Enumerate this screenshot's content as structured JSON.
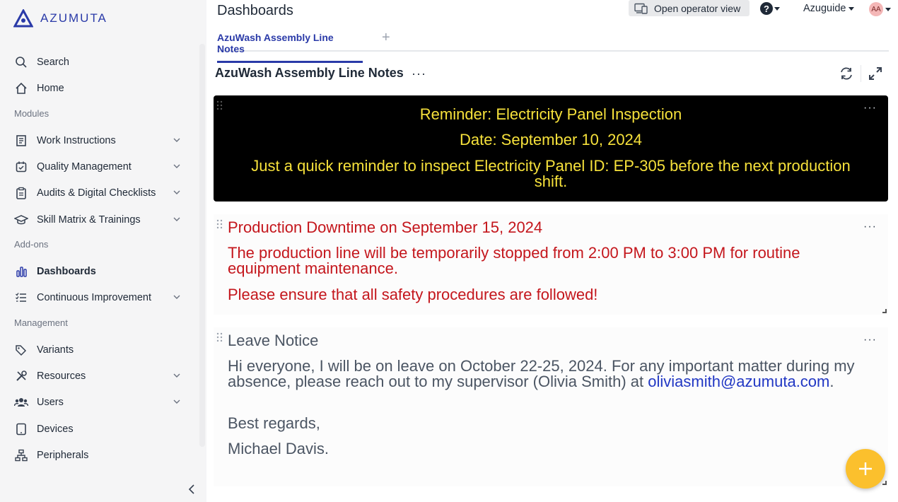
{
  "brand": {
    "name": "AZUMUTA",
    "color": "#2a3aa8"
  },
  "sidebar": {
    "items": [
      {
        "label": "Search",
        "icon": "search-icon"
      },
      {
        "label": "Home",
        "icon": "home-icon"
      },
      {
        "label": "Work Instructions",
        "icon": "document-icon"
      },
      {
        "label": "Quality Management",
        "icon": "calendar-check-icon"
      },
      {
        "label": "Audits & Digital Checklists",
        "icon": "clipboard-icon"
      },
      {
        "label": "Skill Matrix & Trainings",
        "icon": "graduation-cap-icon"
      },
      {
        "label": "Dashboards",
        "icon": "bar-chart-icon"
      },
      {
        "label": "Continuous Improvement",
        "icon": "checklist-icon"
      },
      {
        "label": "Variants",
        "icon": "tags-icon"
      },
      {
        "label": "Resources",
        "icon": "tools-icon"
      },
      {
        "label": "Users",
        "icon": "users-icon"
      },
      {
        "label": "Devices",
        "icon": "tablet-icon"
      },
      {
        "label": "Peripherals",
        "icon": "network-icon"
      }
    ],
    "sections": {
      "modules": "Modules",
      "addons": "Add-ons",
      "management": "Management"
    },
    "active": "Dashboards"
  },
  "header": {
    "title": "Dashboards",
    "operator_view": "Open operator view",
    "help": "?",
    "user": "Azuguide",
    "avatar_initials": "AA"
  },
  "tabs": {
    "active": "AzuWash Assembly Line Notes",
    "add": "+"
  },
  "dashboard": {
    "title": "AzuWash Assembly Line Notes",
    "menu": "···"
  },
  "widgets": {
    "reminder": {
      "title": "Reminder: Electricity Panel Inspection",
      "date": "Date: September 10, 2024",
      "body": "Just a quick reminder to inspect Electricity Panel ID: EP-305 before the next production shift."
    },
    "downtime": {
      "title": "Production Downtime on September 15, 2024",
      "body": "The production line will be temporarily stopped from 2:00 PM to 3:00 PM for routine equipment maintenance.",
      "warning": "Please ensure that all safety procedures are followed!"
    },
    "leave": {
      "title": "Leave Notice",
      "body": "Hi everyone, I will be on leave on October 22-25, 2024. For any important matter during my absence, please reach out to my supervisor (Olivia Smith) at",
      "email": "oliviasmith@azumuta.com",
      "period": ".",
      "closing": "Best regards,",
      "signature": "Michael Davis."
    },
    "menu": "···"
  },
  "colors": {
    "accent": "#2a3aa8",
    "reminder_text": "#f6e13b",
    "alert_red": "#c4161c",
    "fab": "#fbc02d"
  }
}
